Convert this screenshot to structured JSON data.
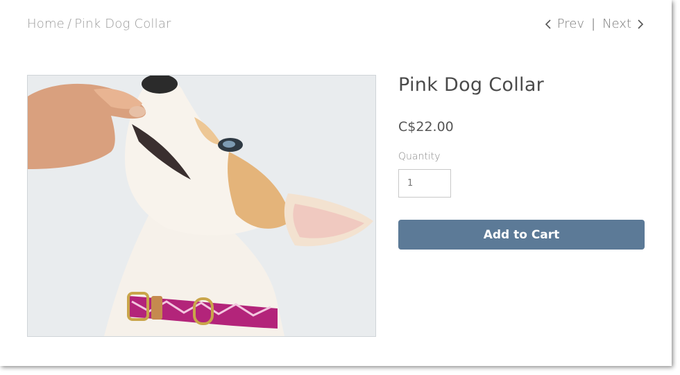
{
  "breadcrumb": {
    "home": "Home",
    "separator": "/",
    "current": "Pink Dog Collar"
  },
  "pager": {
    "prev": "Prev",
    "divider": "|",
    "next": "Next"
  },
  "product": {
    "title": "Pink Dog Collar",
    "price": "C$22.00",
    "quantity_label": "Quantity",
    "quantity_value": "1",
    "add_to_cart": "Add to Cart"
  },
  "colors": {
    "button": "#5c7a97",
    "image_background": "#e9ecee",
    "collar_pink": "#b3247a"
  }
}
